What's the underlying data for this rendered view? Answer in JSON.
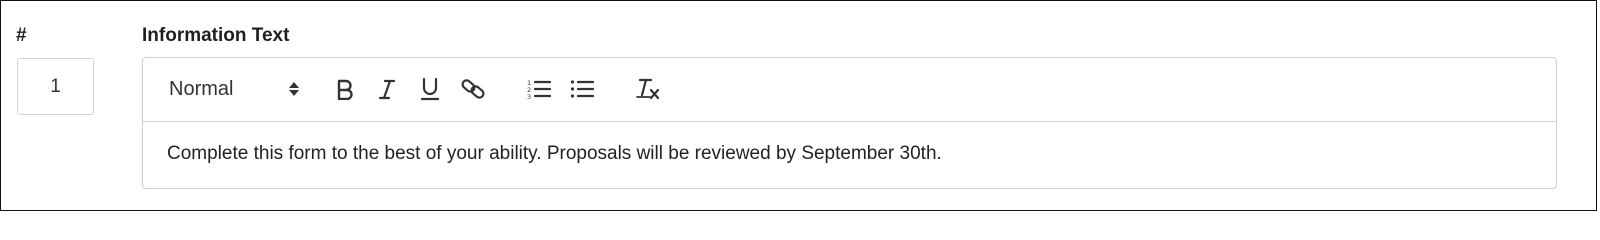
{
  "number_field": {
    "label": "#",
    "value": "1"
  },
  "information_text": {
    "label": "Information Text",
    "toolbar": {
      "format_select": "Normal",
      "buttons": [
        {
          "name": "bold",
          "icon": "bold-icon"
        },
        {
          "name": "italic",
          "icon": "italic-icon"
        },
        {
          "name": "underline",
          "icon": "underline-icon"
        },
        {
          "name": "link",
          "icon": "link-icon"
        },
        {
          "name": "ordered-list",
          "icon": "ordered-list-icon"
        },
        {
          "name": "bullet-list",
          "icon": "bullet-list-icon"
        },
        {
          "name": "clear-formatting",
          "icon": "clear-formatting-icon"
        }
      ]
    },
    "content": "Complete this form to the best of your ability. Proposals will be reviewed by September 30th."
  }
}
